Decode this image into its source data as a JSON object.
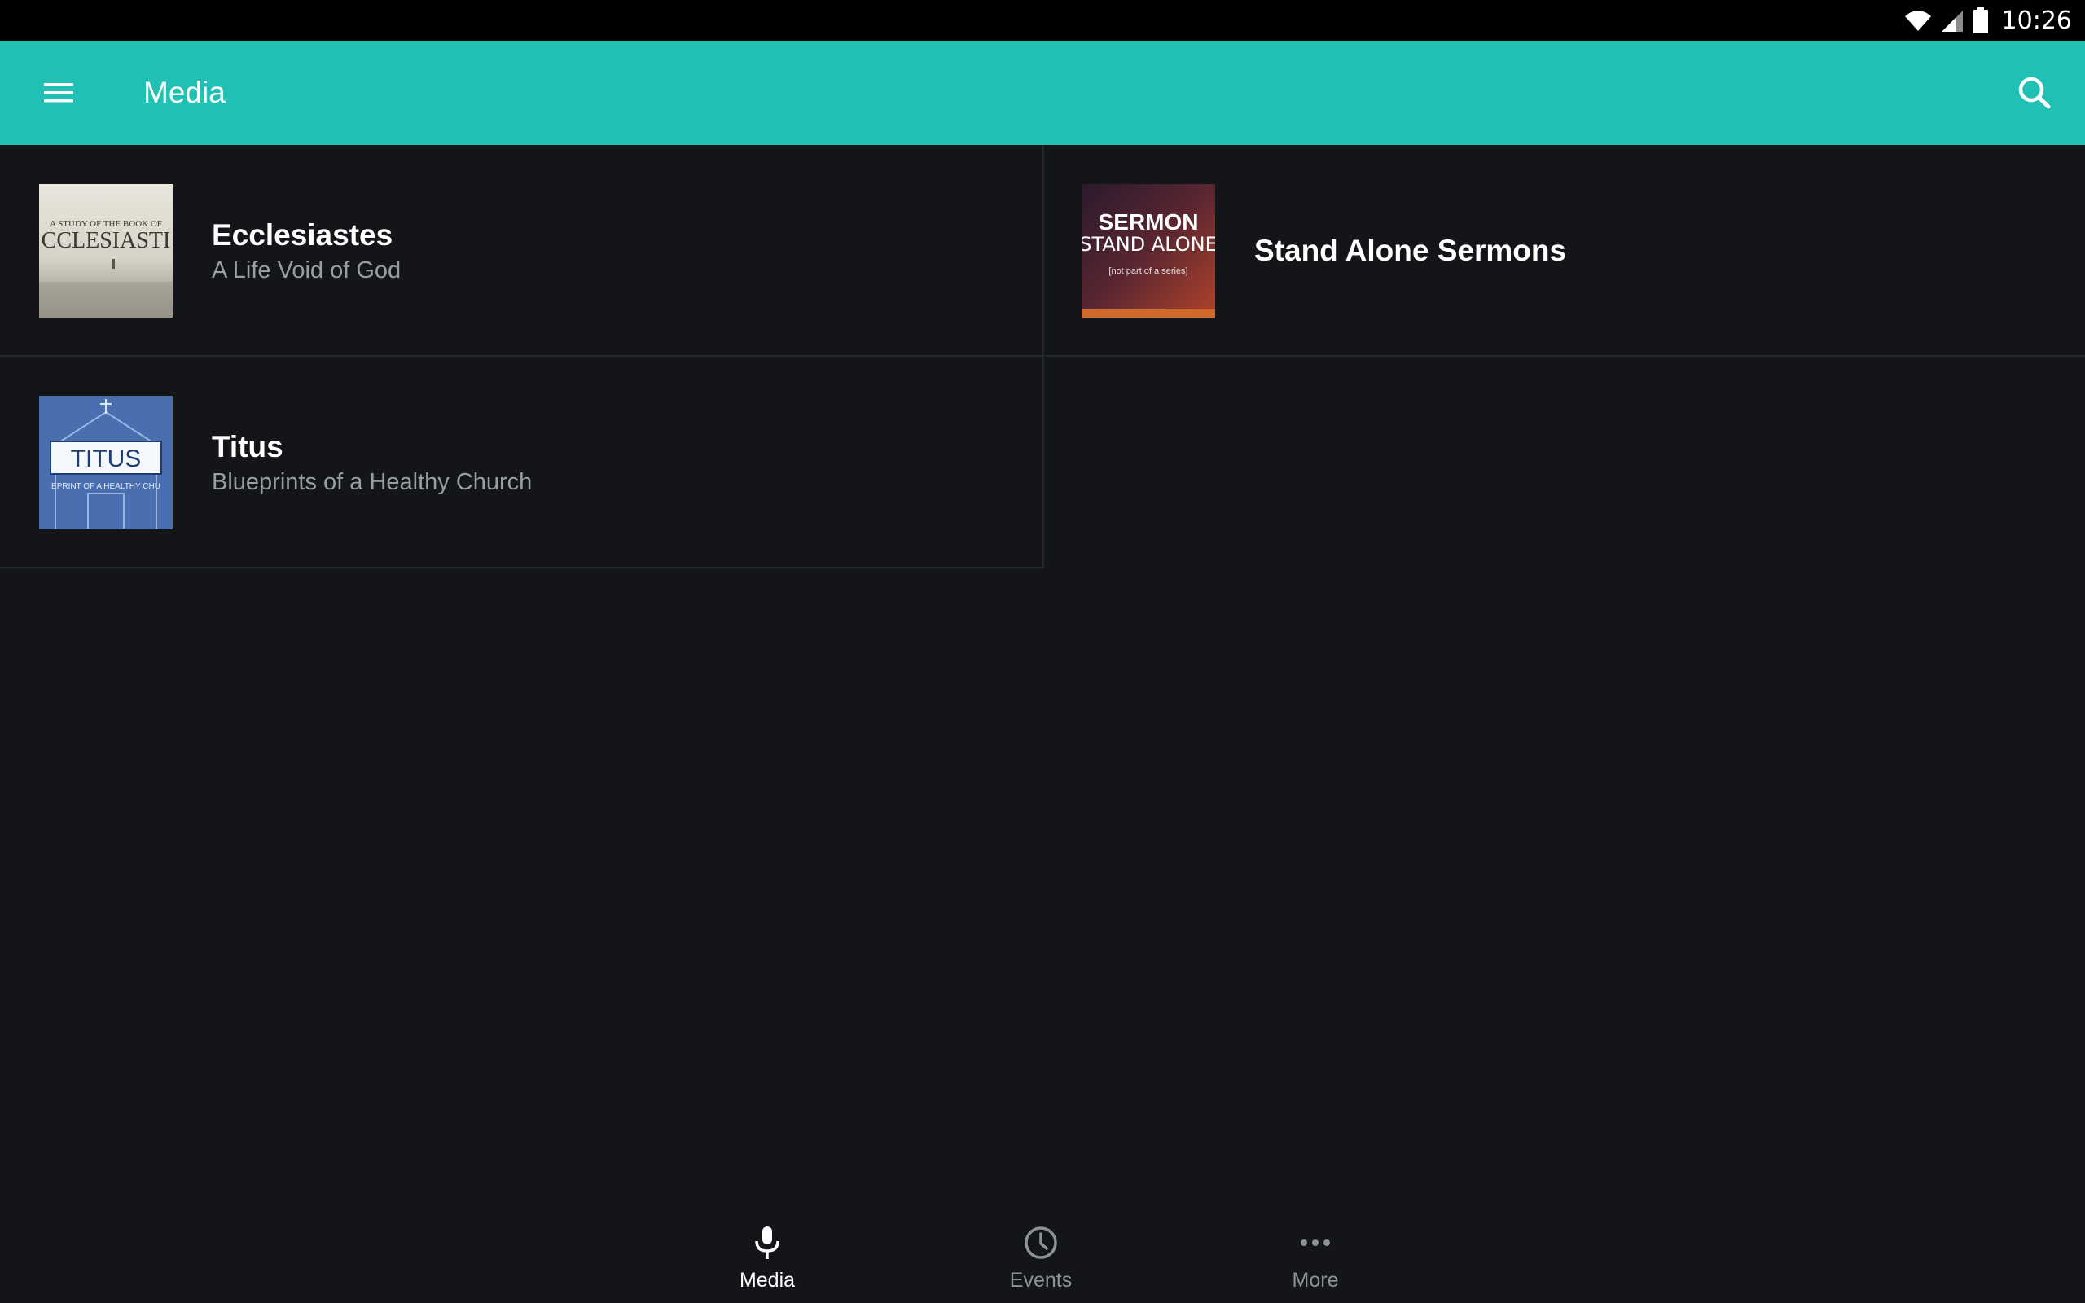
{
  "status_bar": {
    "time": "10:26",
    "icons": [
      "wifi-icon",
      "cell-signal-icon",
      "battery-icon"
    ]
  },
  "app_bar": {
    "title": "Media",
    "menu_icon": "hamburger-menu-icon",
    "search_icon": "search-icon",
    "color": "#20c1b4"
  },
  "series": [
    {
      "title": "Ecclesiastes",
      "subtitle": "A Life Void of God",
      "artwork": {
        "line1": "A STUDY OF THE BOOK OF",
        "line2": "CCLESIASTI"
      }
    },
    {
      "title": "Stand Alone Sermons",
      "subtitle": "",
      "artwork": {
        "line1": "SERMON",
        "line2": "STAND ALONE",
        "line3": "[not part of a series]"
      }
    },
    {
      "title": "Titus",
      "subtitle": "Blueprints of a Healthy Church",
      "artwork": {
        "line1": "TITUS",
        "line2": "EPRINT OF A HEALTHY CHU"
      }
    }
  ],
  "bottom_nav": {
    "items": [
      {
        "label": "Media",
        "icon": "microphone-icon",
        "active": true
      },
      {
        "label": "Events",
        "icon": "clock-icon",
        "active": false
      },
      {
        "label": "More",
        "icon": "more-dots-icon",
        "active": false
      }
    ]
  }
}
